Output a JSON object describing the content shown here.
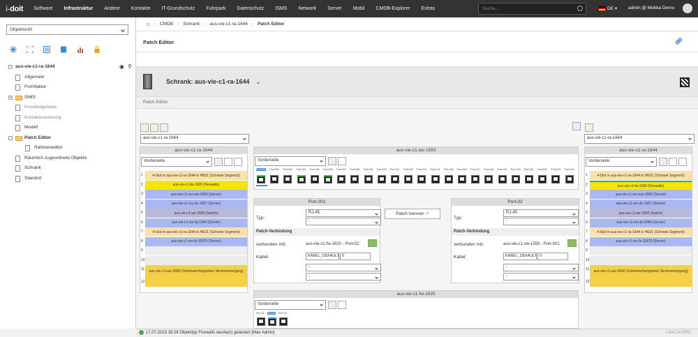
{
  "topbar": {
    "logo_a": "i-",
    "logo_b": "doit",
    "nav": [
      "Software",
      "Infrastruktur",
      "Andere",
      "Kontakte",
      "IT-Grundschutz",
      "Fuhrpark",
      "Datenschutz",
      "ISMS",
      "Network",
      "Server",
      "Mobil",
      "CMDB-Explorer",
      "Extras"
    ],
    "active_nav": "Infrastruktur",
    "search_placeholder": "Suche...",
    "lang": "DE",
    "user": "admin @ Mokka Demo"
  },
  "sidebar": {
    "view_select": "Objektsicht",
    "root": "aus-vie-c1-ra-1644",
    "items": [
      "Allgemein",
      "Formfaktor",
      "ISMS",
      "Knowledgebase",
      "Kontaktzuweisung",
      "Modell",
      "Patch Editor",
      "Rahmeneditor",
      "Räumlich zugeordnete Objekte",
      "Schrank",
      "Standort"
    ]
  },
  "breadcrumb": [
    "CMDB",
    "Schrank",
    "aus-vie-c1-ra-1644",
    "Patch Editor"
  ],
  "page": {
    "title": "Patch Editor",
    "object_title": "Schrank: aus-vie-c1-ra-1644",
    "subheader": "Patch Editor"
  },
  "left_rack": {
    "select": "aus-vie-c1-ra-1644",
    "header": "aus-vie-c1-ra-1644",
    "side": "Vorderseite",
    "units": [
      {
        "n": "1",
        "label": "4-Slot in aus-vie-c1-ra-1644 in HE01 (Schrank Segment)",
        "color": "#fbe0a8"
      },
      {
        "n": "2",
        "label": "aus-vie-c1-fw-1620 (Firewalls)",
        "color": "#f5e500"
      },
      {
        "n": "3",
        "label": "aus-vie-c1-srv-erp-1600 (Server)",
        "color": "#a9b8f0"
      },
      {
        "n": "4",
        "label": "aus-vie-c1-srv-dc-1597 (Server)",
        "color": "#a9b8f0"
      },
      {
        "n": "5",
        "label": "aus-vie-c1-sw-1593 (Switch)",
        "color": "#b8b8d8"
      },
      {
        "n": "6",
        "label": "aus-vie-c1-srv-fp-1594 (Server)",
        "color": "#a9b8f0"
      },
      {
        "n": "7",
        "label": "4-Slot in aus-vie-c1-ra-1644 in HE01 (Schrank Segment)",
        "color": "#fbe0a8"
      },
      {
        "n": "8",
        "label": "aus-vie-c1-srv-fs-11875 (Server)",
        "color": "#a9b8f0"
      },
      {
        "n": "9",
        "label": "",
        "color": "#ececec"
      },
      {
        "n": "10",
        "label": "",
        "color": "#ececec"
      },
      {
        "n": "11",
        "label": "aus-vie-c1-usv-3082 (Unterbrechungsfreie Stromversorgung)",
        "color": "#f5cf46"
      },
      {
        "n": "12",
        "label": "",
        "color": "#f5cf46"
      }
    ]
  },
  "right_rack": {
    "select": "aus-vie-c1-ra-1644",
    "header": "aus-vie-c1-ra-1644",
    "side": "Vorderseite"
  },
  "switch": {
    "header": "aus-vie-c1-sw-1593",
    "side": "Vorderseite",
    "ports": [
      "Port-001",
      "Port-002",
      "Port-003",
      "Port-004",
      "Port-005",
      "Port-006",
      "Port-007",
      "Port-008",
      "Port-009",
      "Port-010",
      "Port-011",
      "Port-012",
      "Port-013",
      "Port-014",
      "Port-015",
      "Port-016",
      "Port-017",
      "Port-018",
      "Port-019",
      "Port-020",
      "Port-021",
      "Port-022",
      "Port-023",
      "Port-024"
    ]
  },
  "port_left": {
    "header": "Port-001",
    "type_label": "Typ:",
    "type": "RJ-45",
    "type2": "-",
    "conn_header": "Patch-Verbindung",
    "connected_label": "verbunden mit:",
    "connected": "aus-vie-c1-fw-1620 - Port-02",
    "cable_label": "Kabel:",
    "cable": "KABEL_DEFAULT",
    "cable_num": "0",
    "sel1": "-",
    "sel2": "-"
  },
  "port_right": {
    "header": "Port-02",
    "type_label": "Typ:",
    "type": "RJ-45",
    "type2": "-",
    "conn_header": "Patch-Verbindung",
    "connected_label": "verbunden mit:",
    "connected": "aus-vie-c1-sw-1593 - Port-001",
    "cable_label": "Kabel:",
    "cable": "KABEL_DEFAULT",
    "cable_num": "0",
    "sel1": "-",
    "sel2": "-"
  },
  "disconnect_button": "Patch trennen",
  "firewall": {
    "header": "aus-vie-c1-fw-1620",
    "side": "Vorderseite",
    "ports": [
      "Port-01",
      "Port-02",
      "Port-03"
    ]
  },
  "status": {
    "text": "17.07.2023 16:28 Objekttyp Firewalls wurde(n) geändert [Max Admin]",
    "version": "i-doit 24 PRO"
  }
}
